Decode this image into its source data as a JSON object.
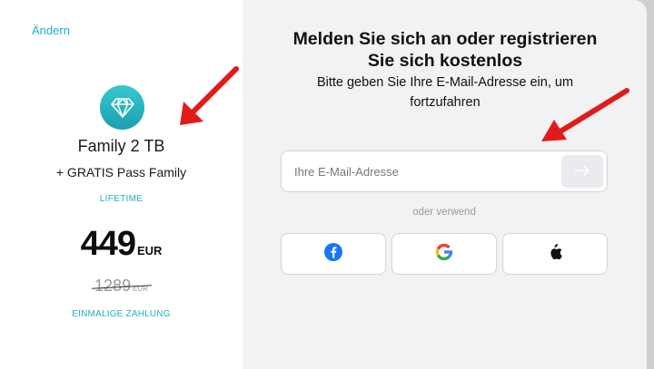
{
  "left_panel": {
    "change_link": "Ändern",
    "plan_icon": "diamond-icon",
    "plan_name": "Family 2 TB",
    "plan_extra": "+ GRATIS Pass Family",
    "plan_term": "LIFETIME",
    "price_amount": "449",
    "price_currency": "EUR",
    "old_price_amount": "1289",
    "old_price_currency": "EUR",
    "payment_note": "EINMALIGE ZAHLUNG"
  },
  "right_panel": {
    "title": "Melden Sie sich an oder registrieren Sie sich kostenlos",
    "subtitle": "Bitte geben Sie Ihre E-Mail-Adresse ein, um fortzufahren",
    "email_placeholder": "Ihre E-Mail-Adresse",
    "submit_icon": "arrow-right-icon",
    "divider_text": "oder verwend",
    "social_buttons": [
      {
        "icon": "facebook-icon"
      },
      {
        "icon": "google-icon"
      },
      {
        "icon": "apple-icon"
      }
    ]
  },
  "colors": {
    "accent": "#1fb2c1",
    "annotation_arrow": "#e01b1b",
    "panel_bg": "#f2f2f2"
  }
}
